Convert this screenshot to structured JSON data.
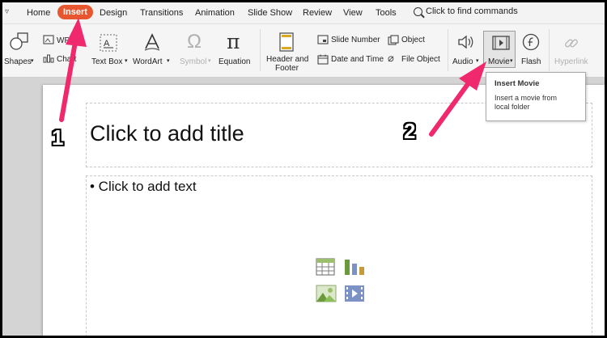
{
  "tabbar": {
    "tabs": [
      "Home",
      "Insert",
      "Design",
      "Transitions",
      "Animation",
      "Slide Show",
      "Review",
      "View",
      "Tools"
    ],
    "active_tab": "Insert",
    "search_text": "Click to find commands"
  },
  "ribbon": {
    "shapes": "Shapes",
    "wps": "WPS",
    "chart": "Chart",
    "textbox": "Text Box",
    "wordart": "WordArt",
    "symbol": "Symbol",
    "equation": "Equation",
    "header_footer_1": "Header and",
    "header_footer_2": "Footer",
    "slide_number": "Slide Number",
    "date_time": "Date and Time",
    "object": "Object",
    "file_object": "File Object",
    "audio": "Audio",
    "movie": "Movie",
    "flash": "Flash",
    "hyperlink": "Hyperlink",
    "accent_color": "#e8562f"
  },
  "slide": {
    "title_placeholder": "Click to add title",
    "text_placeholder": "• Click to add text"
  },
  "tooltip": {
    "title": "Insert Movie",
    "description": "Insert a movie from local folder"
  },
  "annotations": {
    "step1": "1",
    "step2": "2",
    "arrow_color": "#f0286e"
  }
}
